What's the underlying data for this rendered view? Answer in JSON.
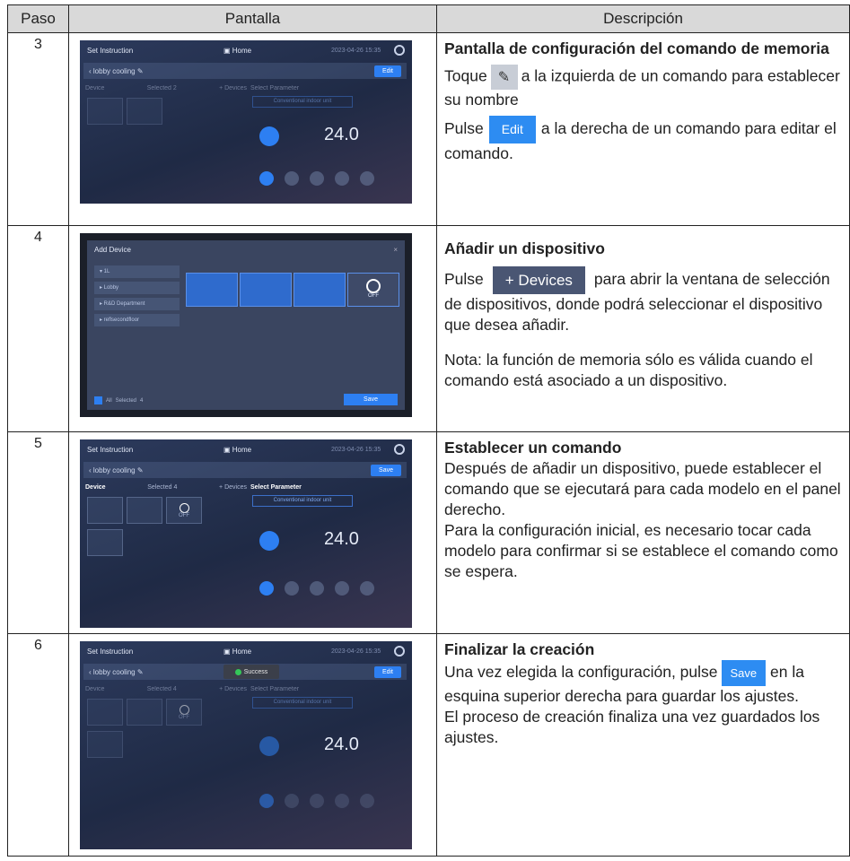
{
  "header": {
    "step": "Paso",
    "screen": "Pantalla",
    "description": "Descripción"
  },
  "rows": [
    {
      "step": "3",
      "title": "Pantalla de configuración del comando de memoria",
      "p1_pre": "Toque",
      "p1_post": "a la izquierda de un comando para establecer su nombre",
      "p2_pre": "Pulse",
      "p2_button": "Edit",
      "p2_post": "a la derecha de un comando para editar el comando.",
      "screen": {
        "title": "Set Instruction",
        "home": "Home",
        "clock": "2023-04-26 15:35",
        "instruction": "lobby cooling",
        "button": "Edit",
        "device": "Device",
        "selected": "Selected 2",
        "devices_btn": "+ Devices",
        "select_param": "Select Parameter",
        "mode_label": "Conventional indoor unit",
        "temp": "24.0"
      }
    },
    {
      "step": "4",
      "title": "Añadir un dispositivo",
      "p1_pre": "Pulse",
      "p1_button": "+ Devices",
      "p1_post": "para abrir la ventana de selección de dispositivos, donde podrá seleccionar el dispositivo que desea añadir.",
      "note": "Nota: la función de memoria sólo es válida cuando el comando está asociado a un dispositivo.",
      "screen": {
        "title": "Add Device",
        "tree": [
          "▾ 1L",
          "▸ Lobby",
          "▸ R&D Department",
          "▸ reflsecondfloor"
        ],
        "all": "All",
        "selected": "Selected",
        "count": "4",
        "save": "Save",
        "off": "OFF"
      }
    },
    {
      "step": "5",
      "title": "Establecer un comando",
      "lines": [
        "Después de añadir un dispositivo, puede establecer el comando que se ejecutará para cada modelo en el panel derecho.",
        "Para la configuración inicial, es necesario tocar cada modelo para confirmar si se establece el comando como se espera."
      ],
      "screen": {
        "title": "Set Instruction",
        "home": "Home",
        "clock": "2023-04-26 15:35",
        "instruction": "lobby cooling",
        "button": "Save",
        "device": "Device",
        "selected": "Selected 4",
        "devices_btn": "+ Devices",
        "select_param": "Select Parameter",
        "mode_label": "Conventional indoor unit",
        "temp": "24.0",
        "off": "OFF"
      }
    },
    {
      "step": "6",
      "title": "Finalizar la creación",
      "p1_pre": "Una vez elegida la configuración, pulse",
      "p1_button": "Save",
      "p1_post": "en la esquina superior derecha para guardar los ajustes.",
      "p2": "El proceso de creación finaliza una vez guardados los ajustes.",
      "screen": {
        "title": "Set Instruction",
        "home": "Home",
        "clock": "2023-04-26 15:35",
        "instruction": "lobby cooling",
        "button": "Edit",
        "toast": "Success",
        "device": "Device",
        "selected": "Selected 4",
        "devices_btn": "+ Devices",
        "select_param": "Select Parameter",
        "mode_label": "Conventional indoor unit",
        "temp": "24.0",
        "off": "OFF"
      }
    }
  ],
  "colors": {
    "accent": "#2d8cf2",
    "screen_bg": "#26324f",
    "header_bg": "#d9d9d9"
  }
}
